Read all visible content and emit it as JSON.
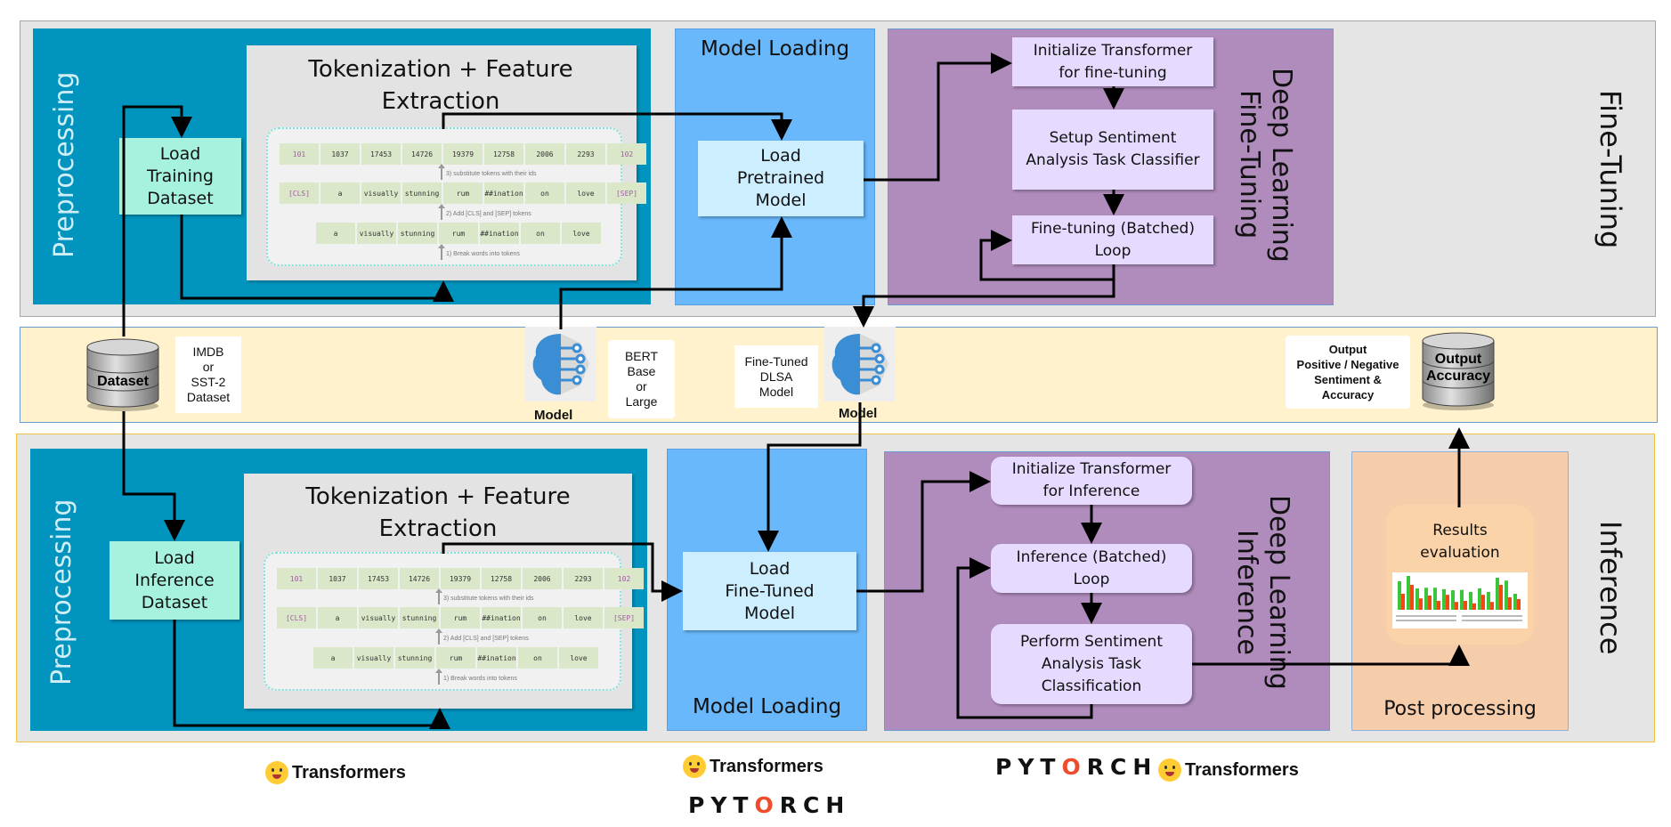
{
  "finetuning_section": {
    "label": "Fine-Tuning",
    "preprocessing": {
      "label": "Preprocessing",
      "load_box": "Load\nTraining\nDataset",
      "tokenization_title": "Tokenization + Feature Extraction"
    },
    "model_loading": {
      "label": "Model Loading",
      "load_box": "Load\nPretrained\nModel"
    },
    "deep_learning": {
      "label": "Deep Learning\nFine-Tuning",
      "steps": [
        "Initialize Transformer\nfor fine-tuning",
        "Setup Sentiment\nAnalysis Task Classifier",
        "Fine-tuning (Batched)\nLoop"
      ]
    }
  },
  "middle_band": {
    "dataset_db_label": "Dataset",
    "dataset_note": "IMDB\nor\nSST-2\nDataset",
    "model1_label": "Model",
    "model1_note": "BERT\nBase\nor\nLarge",
    "model2_note": "Fine-Tuned\nDLSA\nModel",
    "model2_label": "Model",
    "output_note": "Output\nPositive / Negative\nSentiment  &\nAccuracy",
    "output_db_label": "Output\nAccuracy"
  },
  "inference_section": {
    "label": "Inference",
    "preprocessing": {
      "label": "Preprocessing",
      "load_box": "Load\nInference\nDataset",
      "tokenization_title": "Tokenization + Feature Extraction"
    },
    "model_loading": {
      "label": "Model Loading",
      "load_box": "Load\nFine-Tuned\nModel"
    },
    "deep_learning": {
      "label": "Deep Learning\nInference",
      "steps": [
        "Initialize Transformer\nfor Inference",
        "Inference (Batched)\nLoop",
        "Perform Sentiment\nAnalysis Task\nClassification"
      ]
    },
    "post_processing": {
      "label": "Post processing",
      "results": "Results\nevaluation"
    }
  },
  "tokenization_example": {
    "ids": [
      "101",
      "1037",
      "17453",
      "14726",
      "19379",
      "12758",
      "2006",
      "2293",
      "102"
    ],
    "with_special": [
      "[CLS]",
      "a",
      "visually",
      "stunning",
      "rum",
      "##ination",
      "on",
      "love",
      "[SEP]"
    ],
    "tokens": [
      "a",
      "visually",
      "stunning",
      "rum",
      "##ination",
      "on",
      "love"
    ],
    "step3": "3) substitute tokens with their ids",
    "step2": "2) Add [CLS] and [SEP] tokens",
    "step1": "1) Break words into tokens"
  },
  "logos": {
    "transformers": "Transformers",
    "pytorch_pre": "PYT",
    "pytorch_o": "O",
    "pytorch_post": "RCH"
  },
  "colors": {
    "teal": "#0094be",
    "blue": "#69b8fb",
    "purple": "#b08cbd",
    "peach": "#f6cdaa",
    "band": "#fff2cc"
  }
}
